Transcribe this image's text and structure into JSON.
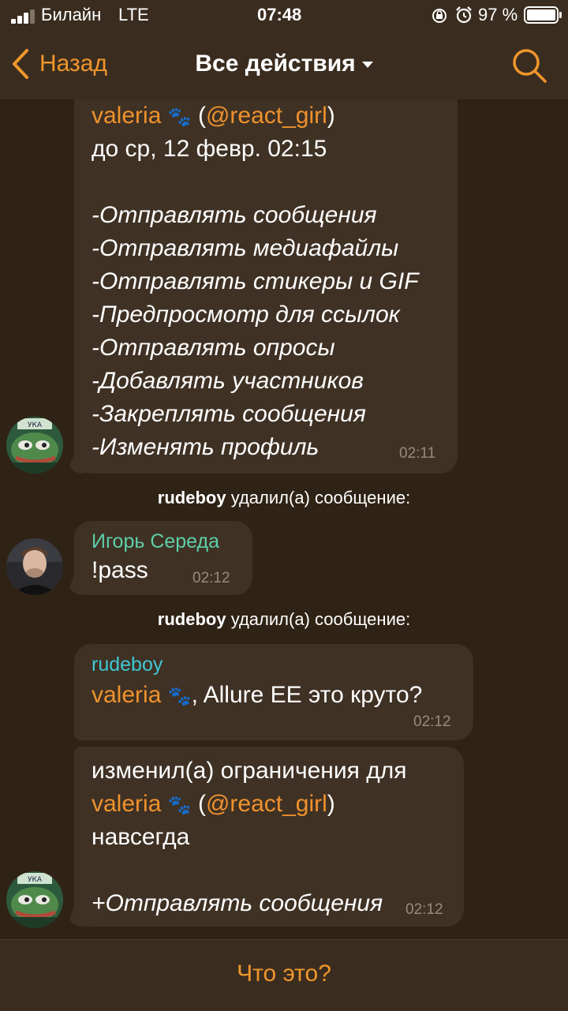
{
  "status_bar": {
    "carrier": "Билайн",
    "network": "LTE",
    "time": "07:48",
    "battery": "97 %"
  },
  "nav": {
    "back_label": "Назад",
    "title": "Все действия",
    "search_icon": "search-icon"
  },
  "messages": {
    "m1": {
      "user_name": "valeria",
      "user_handle": "@react_girl",
      "until": "до ср, 12 февр. 02:15",
      "restrictions": [
        "-Отправлять сообщения",
        "-Отправлять медиафайлы",
        "-Отправлять стикеры и GIF",
        "-Предпросмотр для ссылок",
        "-Отправлять опросы",
        "-Добавлять участников",
        "-Закреплять сообщения",
        "-Изменять профиль"
      ],
      "time": "02:11"
    },
    "sys1": {
      "actor": "rudeboy",
      "action": "удалил(а) сообщение:"
    },
    "m2": {
      "sender": "Игорь Середа",
      "text": "!pass",
      "time": "02:12"
    },
    "sys2": {
      "actor": "rudeboy",
      "action": "удалил(а) сообщение:"
    },
    "m3": {
      "sender": "rudeboy",
      "mention": "valeria",
      "text": ", Allure EE это круто?",
      "time": "02:12"
    },
    "m4": {
      "line1": "изменил(а) ограничения для",
      "user_name": "valeria",
      "user_handle": "@react_girl",
      "line3": "навсегда",
      "restriction": "+Отправлять сообщения",
      "time": "02:12"
    }
  },
  "bottom": {
    "button_label": "Что это?"
  },
  "colors": {
    "accent": "#f0962c",
    "background": "#2f2316",
    "bubble": "#3f3124",
    "green_name": "#5dcfa9",
    "teal_name": "#3fc7d5"
  }
}
